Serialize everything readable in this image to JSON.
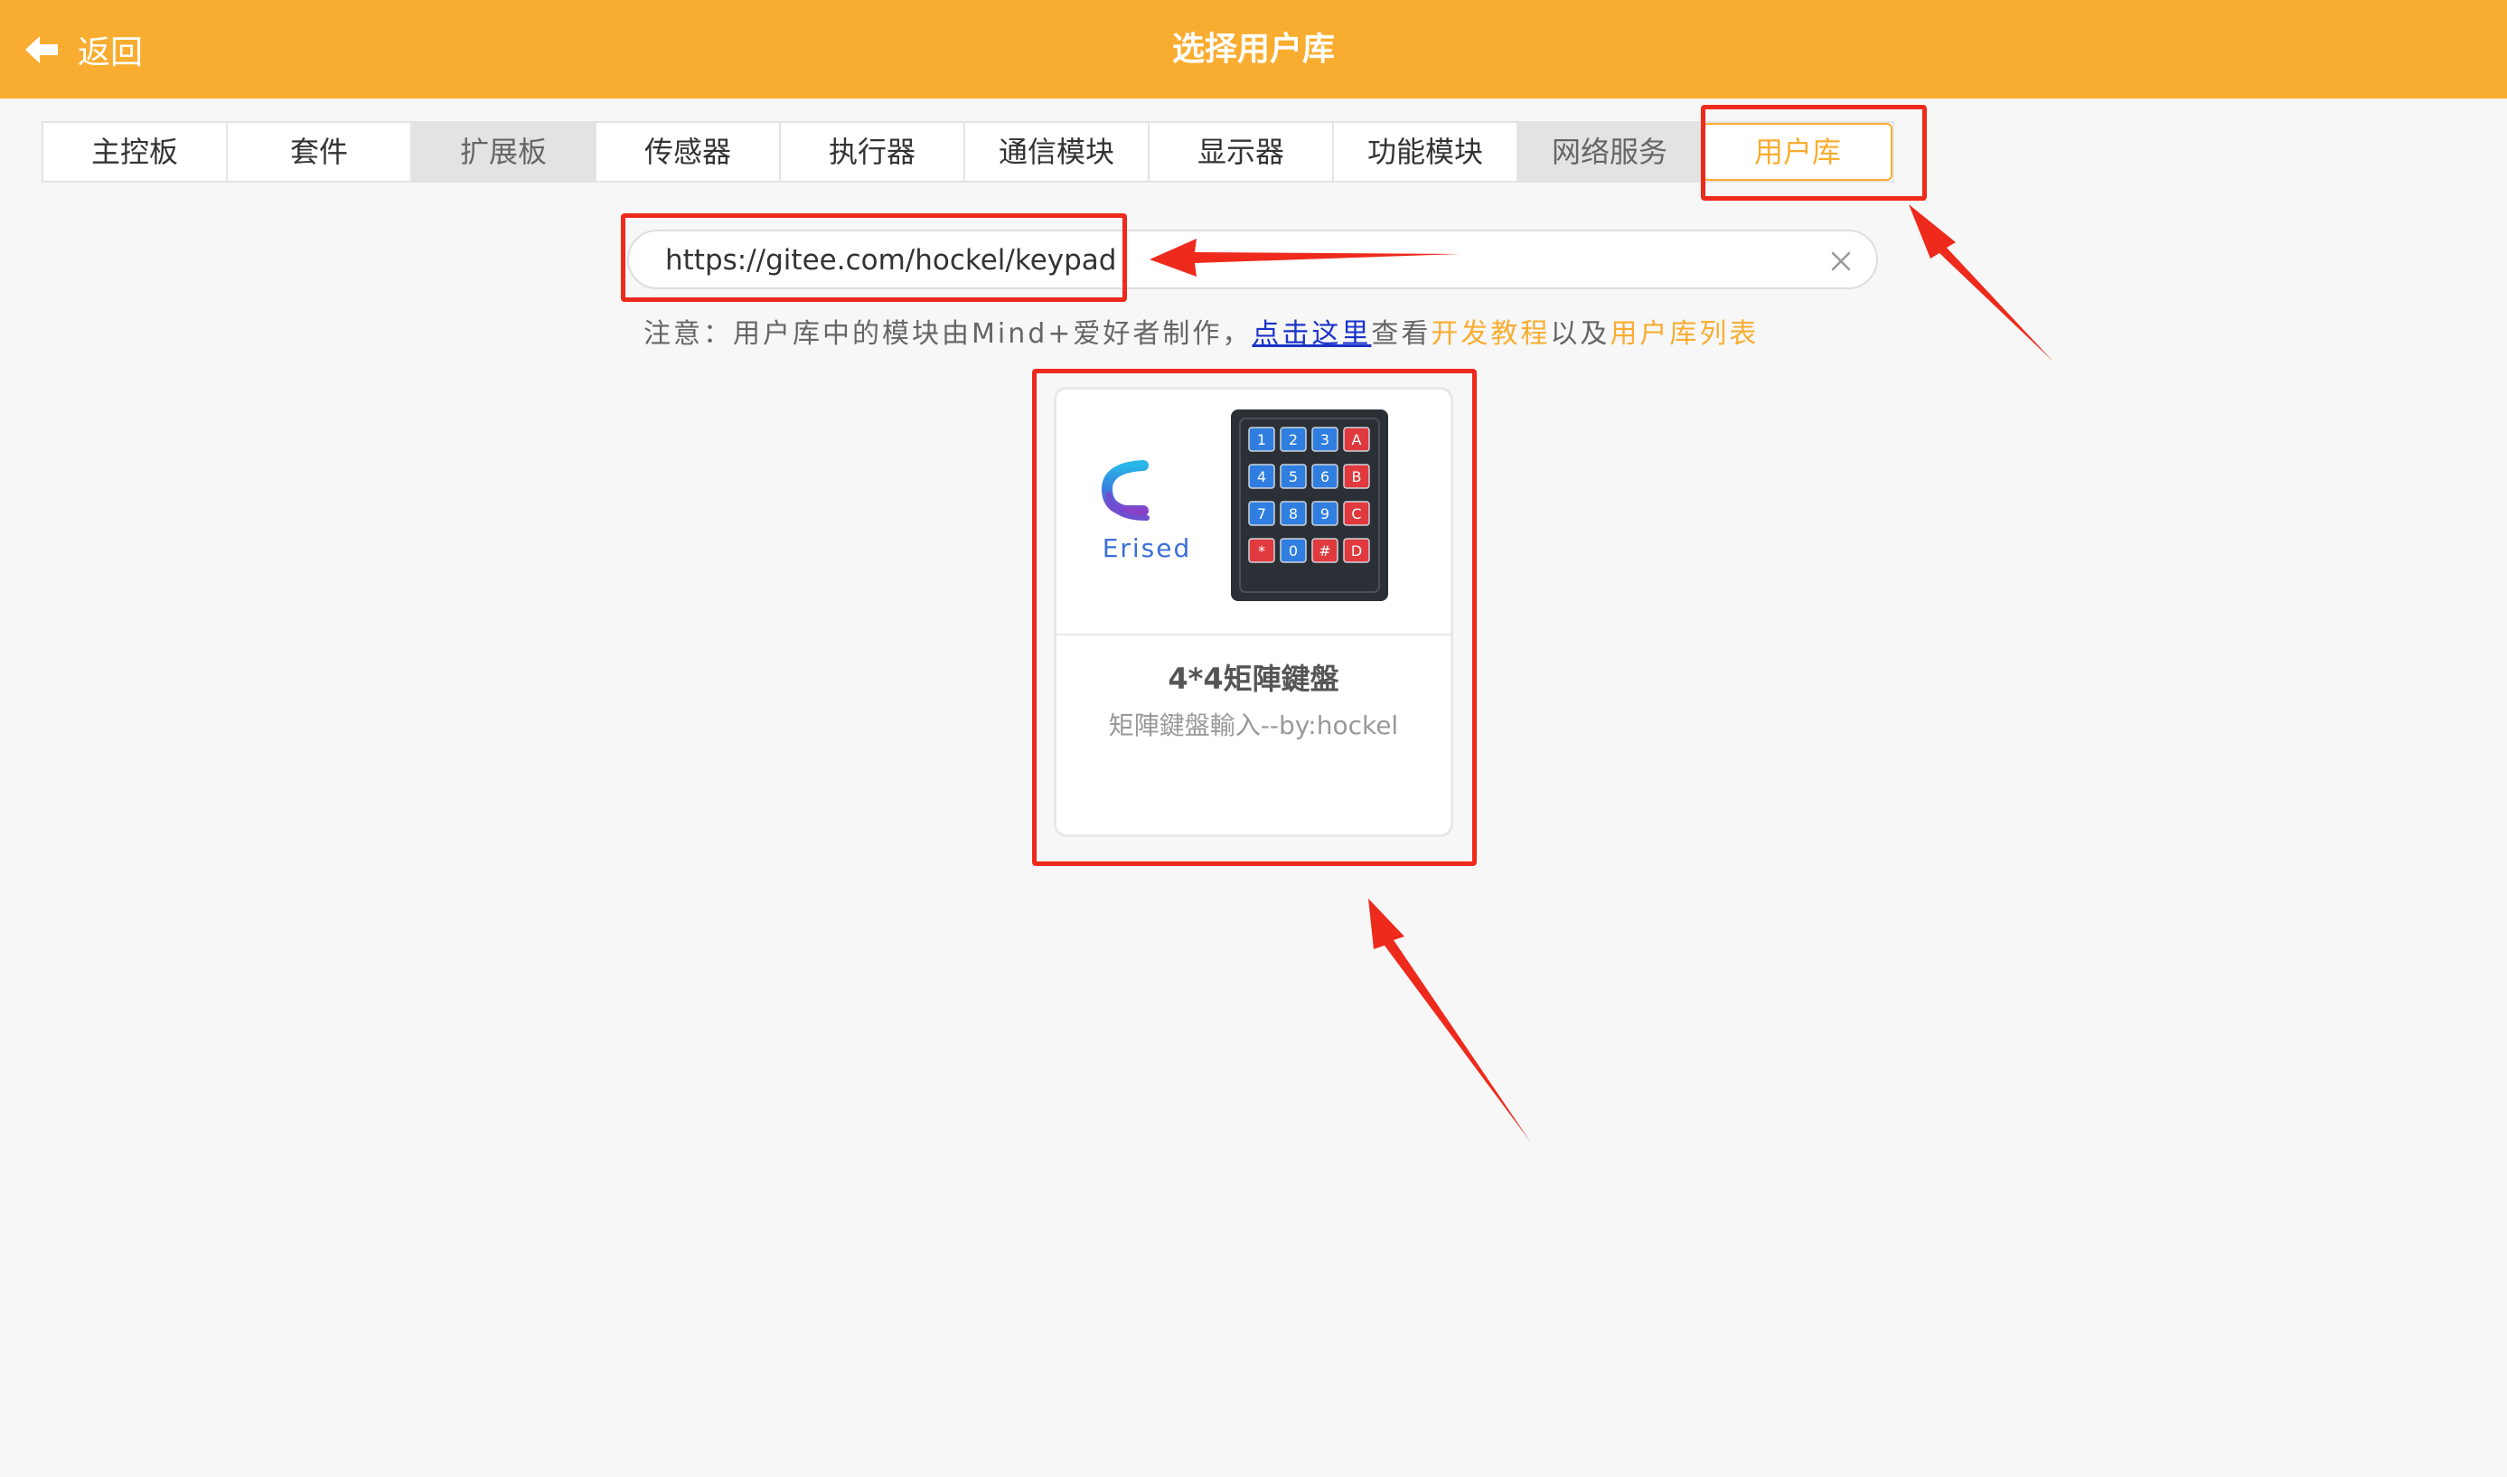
{
  "header": {
    "back_label": "返回",
    "title": "选择用户库",
    "background_color": "#f9ad30"
  },
  "tabs": [
    {
      "label": "主控板"
    },
    {
      "label": "套件"
    },
    {
      "label": "扩展板"
    },
    {
      "label": "传感器"
    },
    {
      "label": "执行器"
    },
    {
      "label": "通信模块"
    },
    {
      "label": "显示器"
    },
    {
      "label": "功能模块"
    },
    {
      "label": "网络服务"
    },
    {
      "label": "用户库",
      "active": true
    }
  ],
  "search": {
    "value": "https://gitee.com/hockel/keypad"
  },
  "notice": {
    "prefix": "注意：用户库中的模块由Mind+爱好者制作，",
    "link_here": "点击这里",
    "view": "查看",
    "dev_tutorial": "开发教程",
    "and": "以及",
    "user_lib_list": "用户库列表"
  },
  "card": {
    "logo_text": "Erised",
    "title": "4*4矩陣鍵盤",
    "description": "矩陣鍵盤輸入--by:hockel",
    "keypad_keys": [
      "1",
      "2",
      "3",
      "A",
      "4",
      "5",
      "6",
      "B",
      "7",
      "8",
      "9",
      "C",
      "*",
      "0",
      "#",
      "D"
    ]
  },
  "colors": {
    "accent": "#f9ad30",
    "annotation": "#ee2a1c",
    "link": "#1a33c9"
  }
}
